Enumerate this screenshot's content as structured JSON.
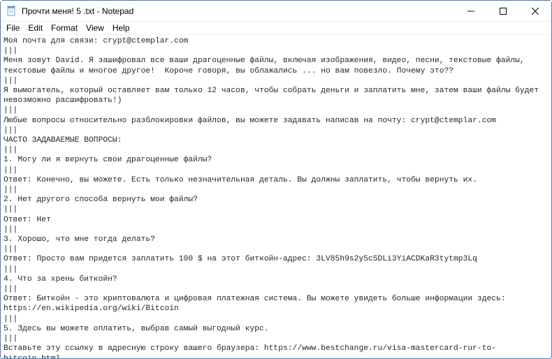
{
  "window": {
    "title": "Прочти меня! 5 .txt - Notepad"
  },
  "menu": {
    "file": "File",
    "edit": "Edit",
    "format": "Format",
    "view": "View",
    "help": "Help"
  },
  "content": {
    "lines": [
      "Моя почта для связи: crypt@ctemplar.com",
      "|||",
      "Меня зовут David. Я зашифровал все ваши драгоценные файлы, включая изображения, видео, песни, текстовые файлы, текстовые файлы и многое другое!  Короче говоря, вы облажались ... но вам повезло. Почему это??",
      "|||",
      "Я вымогатель, который оставляет вам только 12 часов, чтобы собрать деньги и заплатить мне, затем ваши файлы будет невозможно расшифровать!)",
      "|||",
      "Любые вопросы относительно разблокировки файлов, вы можете задавать написав на почту: crypt@ctemplar.com",
      "|||",
      "ЧАСТО ЗАДАВАЕМЫЕ ВОПРОСЫ:",
      "|||",
      "1. Могу ли я вернуть свои драгоценные файлы?",
      "|||",
      "Ответ: Конечно, вы можете. Есть только незначительная деталь. Вы должны заплатить, чтобы вернуть их.",
      "|||",
      "2. Нет другого способа вернуть мои файлы?",
      "|||",
      "Ответ: Нет",
      "|||",
      "3. Хорошо, что мне тогда делать?",
      "|||",
      "Ответ: Просто вам придется заплатить 100 $ на этот биткойн-адрес: 3LV85h9s2y5c5DLi3YiACDKaR3tytmp3Lq",
      "|||",
      "4. Что за хрень биткойн?",
      "|||",
      "Ответ: Биткойн - это криптовалюта и цифровая платежная система. Вы можете увидеть больше информации здесь: https://en.wikipedia.org/wiki/Bitcoin",
      "|||",
      "5. Здесь вы можете оплатить, выбрав самый выгодный курс.",
      "|||",
      "Вставьте эту ссылку в адресную строку вашего браузера: https://www.bestchange.ru/visa-mastercard-rur-to-bitcoin.html"
    ]
  }
}
